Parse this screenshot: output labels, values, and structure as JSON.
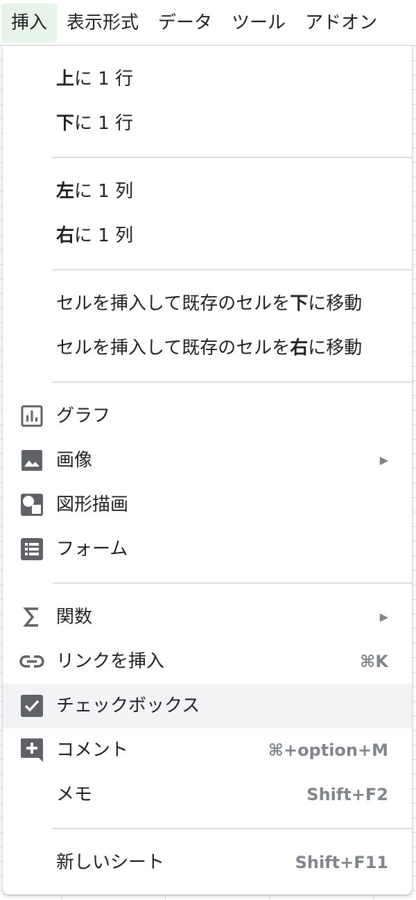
{
  "menubar": {
    "items": [
      "挿入",
      "表示形式",
      "データ",
      "ツール",
      "アドオン"
    ]
  },
  "insert_menu": {
    "row_above": {
      "bold": "上",
      "rest": "に 1 行"
    },
    "row_below": {
      "bold": "下",
      "rest": "に 1 行"
    },
    "col_left": {
      "bold": "左",
      "rest": "に 1 列"
    },
    "col_right": {
      "bold": "右",
      "rest": "に 1 列"
    },
    "shift_down": {
      "pre": "セルを挿入して既存のセルを",
      "bold": "下",
      "post": "に移動"
    },
    "shift_right": {
      "pre": "セルを挿入して既存のセルを",
      "bold": "右",
      "post": "に移動"
    },
    "chart": {
      "label": "グラフ",
      "icon": "bar-chart-icon"
    },
    "image": {
      "label": "画像",
      "icon": "image-icon",
      "arrow": "▶"
    },
    "drawing": {
      "label": "図形描画",
      "icon": "shapes-icon"
    },
    "form": {
      "label": "フォーム",
      "icon": "form-list-icon"
    },
    "function": {
      "label": "関数",
      "icon": "sigma-icon",
      "arrow": "▶"
    },
    "link": {
      "label": "リンクを挿入",
      "icon": "link-icon",
      "shortcut": "⌘K"
    },
    "checkbox": {
      "label": "チェックボックス",
      "icon": "checkbox-icon"
    },
    "comment": {
      "label": "コメント",
      "icon": "add-comment-icon",
      "shortcut": "⌘+option+M"
    },
    "note": {
      "label": "メモ",
      "shortcut": "Shift+F2"
    },
    "new_sheet": {
      "label": "新しいシート",
      "shortcut": "Shift+F11"
    }
  },
  "colors": {
    "active_tab_bg": "#e6f4ea",
    "highlight_bg": "#f1f3f4",
    "icon": "#5f6368",
    "shortcut": "#80868b"
  }
}
